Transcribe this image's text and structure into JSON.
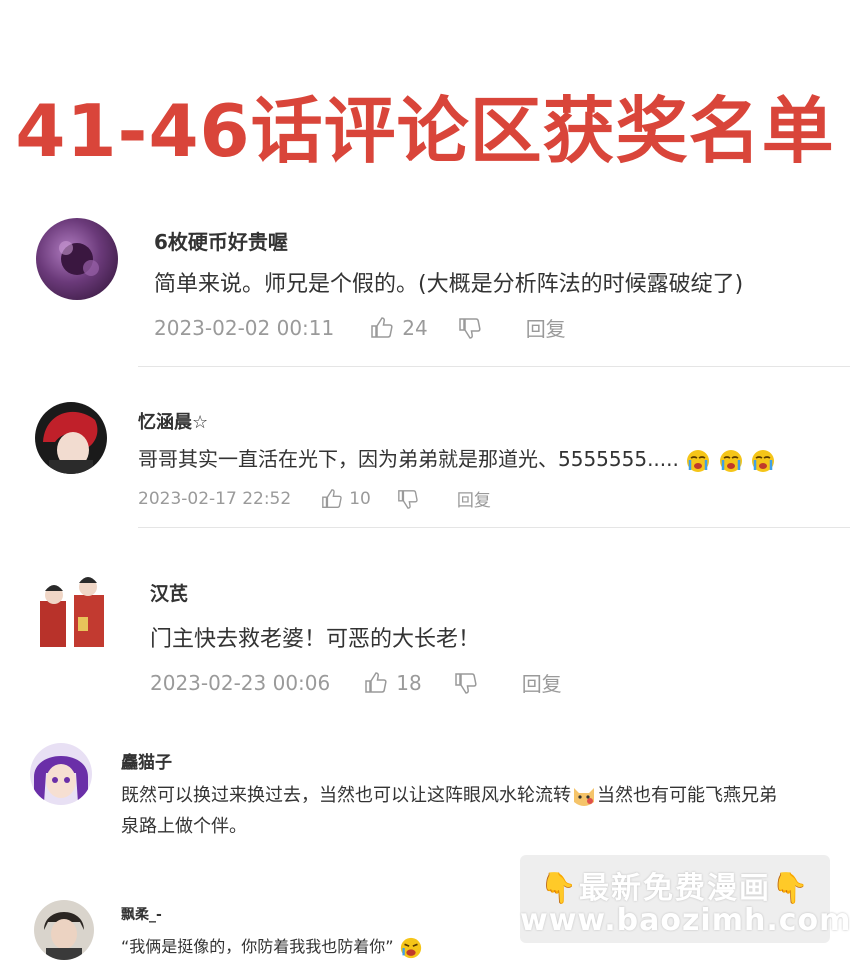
{
  "title": "41-46话评论区获奖名单",
  "comments": [
    {
      "username": "6枚硬币好贵喔",
      "text": "简单来说。师兄是个假的。(大概是分析阵法的时候露破绽了)",
      "timestamp": "2023-02-02 00:11",
      "likes": "24",
      "reply_label": "回复"
    },
    {
      "username": "忆涵晨☆",
      "text": "哥哥其实一直活在光下，因为弟弟就是那道光、5555555.....",
      "timestamp": "2023-02-17 22:52",
      "likes": "10",
      "reply_label": "回复"
    },
    {
      "username": "汉芪",
      "text": "门主快去救老婆！可恶的大长老！",
      "timestamp": "2023-02-23 00:06",
      "likes": "18",
      "reply_label": "回复"
    },
    {
      "username": "麤猫子",
      "text_line1_a": "既然可以换过来换过去，当然也可以让这阵眼风水轮流转",
      "text_line1_b": "当然也有可能飞燕兄弟",
      "text_line2": "泉路上做个伴。"
    },
    {
      "username": "飘柔_-",
      "text": "“我俩是挺像的，你防着我我也防着你”"
    }
  ],
  "watermark": {
    "line1": "最新免费漫画",
    "line2": "www.baozimh.com",
    "finger_icon": "pointing-down-icon"
  },
  "colors": {
    "title": "#d9453a",
    "meta": "#9a9a9a",
    "text": "#333333"
  }
}
